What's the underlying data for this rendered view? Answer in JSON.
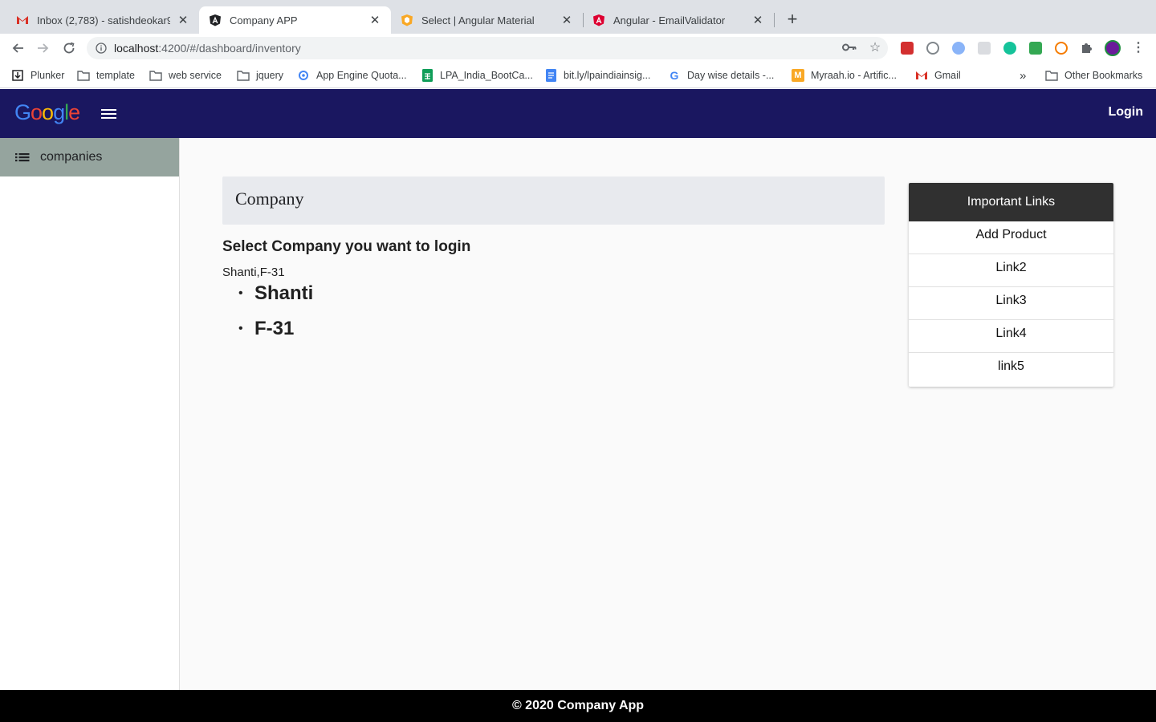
{
  "browser": {
    "tabs": [
      {
        "title": "Inbox (2,783) - satishdeokar94",
        "icon": "gmail-icon"
      },
      {
        "title": "Company APP",
        "icon": "angular-icon"
      },
      {
        "title": "Select | Angular Material",
        "icon": "angular-material-icon"
      },
      {
        "title": "Angular - EmailValidator",
        "icon": "angular-icon"
      }
    ],
    "url_host": "localhost",
    "url_path": ":4200/#/dashboard/inventory",
    "bookmarks": [
      {
        "label": "Plunker",
        "icon": "plunker-icon"
      },
      {
        "label": "template",
        "icon": "folder-icon"
      },
      {
        "label": "web service",
        "icon": "folder-icon"
      },
      {
        "label": "jquery",
        "icon": "folder-icon"
      },
      {
        "label": "App Engine Quota...",
        "icon": "app-engine-icon"
      },
      {
        "label": "LPA_India_BootCa...",
        "icon": "sheets-icon"
      },
      {
        "label": "bit.ly/lpaindiainsig...",
        "icon": "docs-icon"
      },
      {
        "label": "Day wise details -...",
        "icon": "google-icon"
      },
      {
        "label": "Myraah.io - Artific...",
        "icon": "myraah-icon"
      },
      {
        "label": "Gmail",
        "icon": "gmail-icon"
      }
    ],
    "other_bookmarks": "Other Bookmarks",
    "overflow": "»"
  },
  "app": {
    "logo_letters": [
      "G",
      "o",
      "o",
      "g",
      "l",
      "e"
    ],
    "login_label": "Login",
    "nav": [
      {
        "label": "companies",
        "icon": "list-icon"
      }
    ],
    "company_title": "Company",
    "heading": "Select Company you want to login",
    "selected_text": "Shanti,F-31",
    "companies": [
      "Shanti",
      "F-31"
    ],
    "important_links": {
      "title": "Important Links",
      "links": [
        "Add Product",
        "Link2",
        "Link3",
        "Link4",
        "link5"
      ]
    },
    "footer": "© 2020 Company App"
  },
  "colors": {
    "appbar": "#1a1760",
    "nav_active": "#95a49e",
    "links_header": "#303030",
    "footer": "#000000"
  }
}
